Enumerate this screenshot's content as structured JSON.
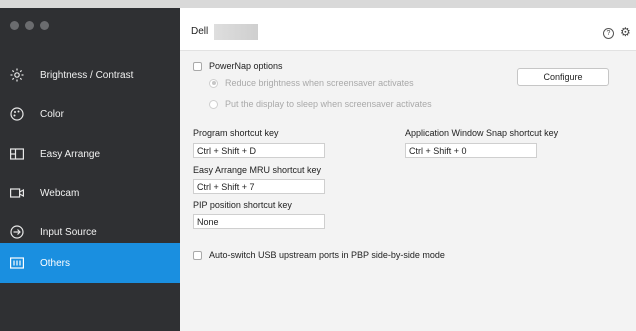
{
  "window": {
    "brand": "Dell"
  },
  "header": {
    "help_glyph": "?",
    "settings_glyph": "⚙"
  },
  "sidebar": {
    "items": [
      {
        "label": "Brightness / Contrast",
        "icon": "brightness-icon",
        "active": false
      },
      {
        "label": "Color",
        "icon": "color-palette-icon",
        "active": false
      },
      {
        "label": "Easy Arrange",
        "icon": "layout-icon",
        "active": false
      },
      {
        "label": "Webcam",
        "icon": "webcam-icon",
        "active": false
      },
      {
        "label": "Input Source",
        "icon": "input-source-icon",
        "active": false
      },
      {
        "label": "Others",
        "icon": "others-icon",
        "active": true
      }
    ]
  },
  "powernap": {
    "label": "PowerNap options",
    "option1": "Reduce brightness when screensaver activates",
    "option2": "Put the display to sleep when screensaver activates",
    "configure_label": "Configure"
  },
  "shortcuts": {
    "program": {
      "label": "Program shortcut key",
      "value": "Ctrl + Shift + D"
    },
    "snap": {
      "label": "Application Window Snap shortcut key",
      "value": "Ctrl + Shift + 0"
    },
    "mru": {
      "label": "Easy Arrange MRU shortcut key",
      "value": "Ctrl + Shift + 7"
    },
    "pip": {
      "label": "PIP position shortcut key",
      "value": "None"
    }
  },
  "usb": {
    "label": "Auto-switch USB upstream ports in PBP side-by-side mode"
  },
  "colors": {
    "sidebar_bg": "#2f3033",
    "active_bg": "#1a8fe0",
    "content_bg": "#f3f3f3"
  }
}
